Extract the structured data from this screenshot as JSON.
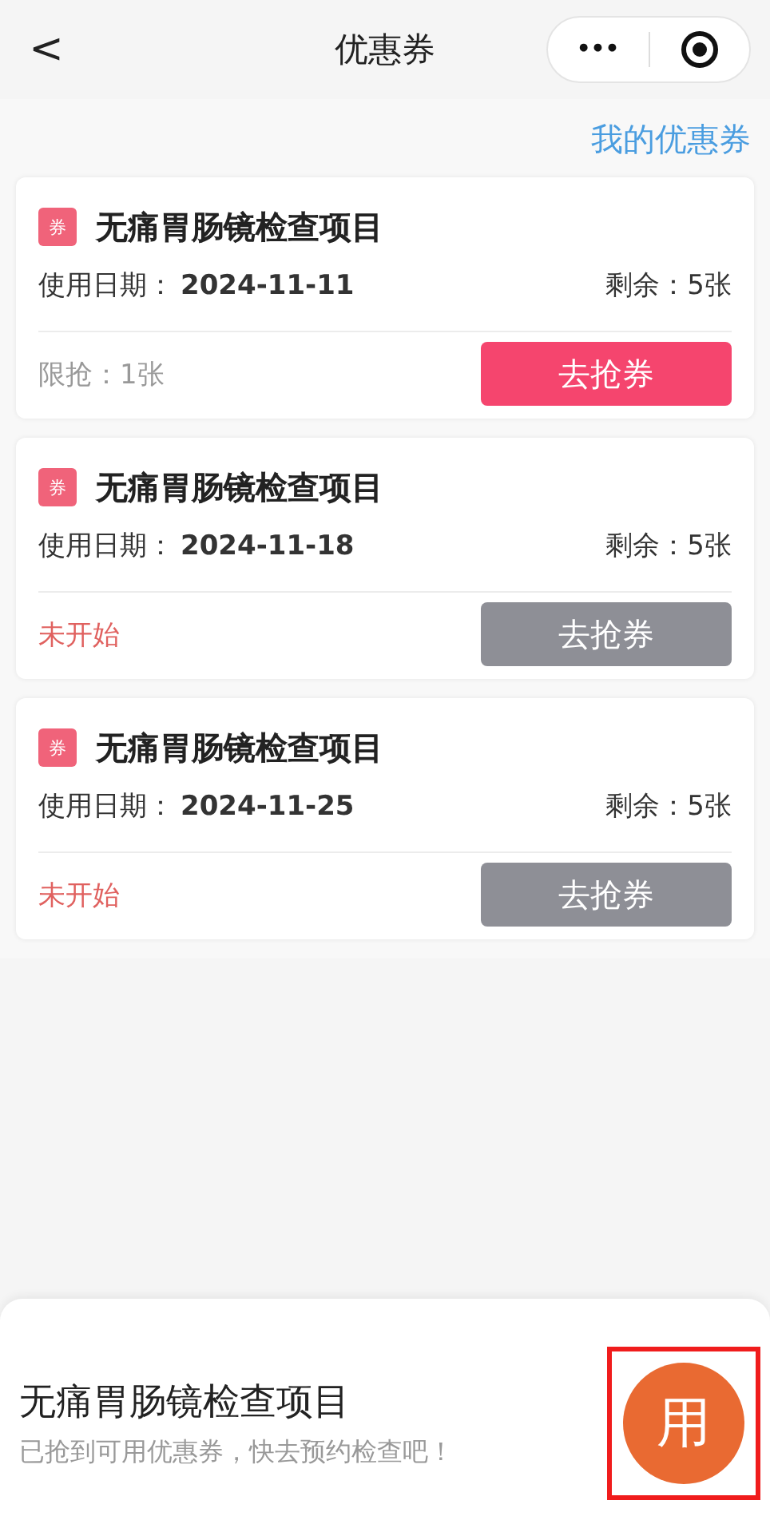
{
  "header": {
    "back": "<",
    "title": "优惠券",
    "more": "•••"
  },
  "my_coupons_link": "我的优惠券",
  "coupons": [
    {
      "tag": "券",
      "name": "无痛胃肠镜检查项目",
      "date_label": "使用日期：",
      "date": "2024-11-11",
      "remaining": "剩余：5张",
      "note": "限抢：1张",
      "button": "去抢券",
      "active": true
    },
    {
      "tag": "券",
      "name": "无痛胃肠镜检查项目",
      "date_label": "使用日期：",
      "date": "2024-11-18",
      "remaining": "剩余：5张",
      "note": "未开始",
      "button": "去抢券",
      "active": false
    },
    {
      "tag": "券",
      "name": "无痛胃肠镜检查项目",
      "date_label": "使用日期：",
      "date": "2024-11-25",
      "remaining": "剩余：5张",
      "note": "未开始",
      "button": "去抢券",
      "active": false
    }
  ],
  "bottom_bar": {
    "title": "无痛胃肠镜检查项目",
    "subtitle": "已抢到可用优惠券，快去预约检查吧！",
    "use_button": "用",
    "highlighted": true
  }
}
